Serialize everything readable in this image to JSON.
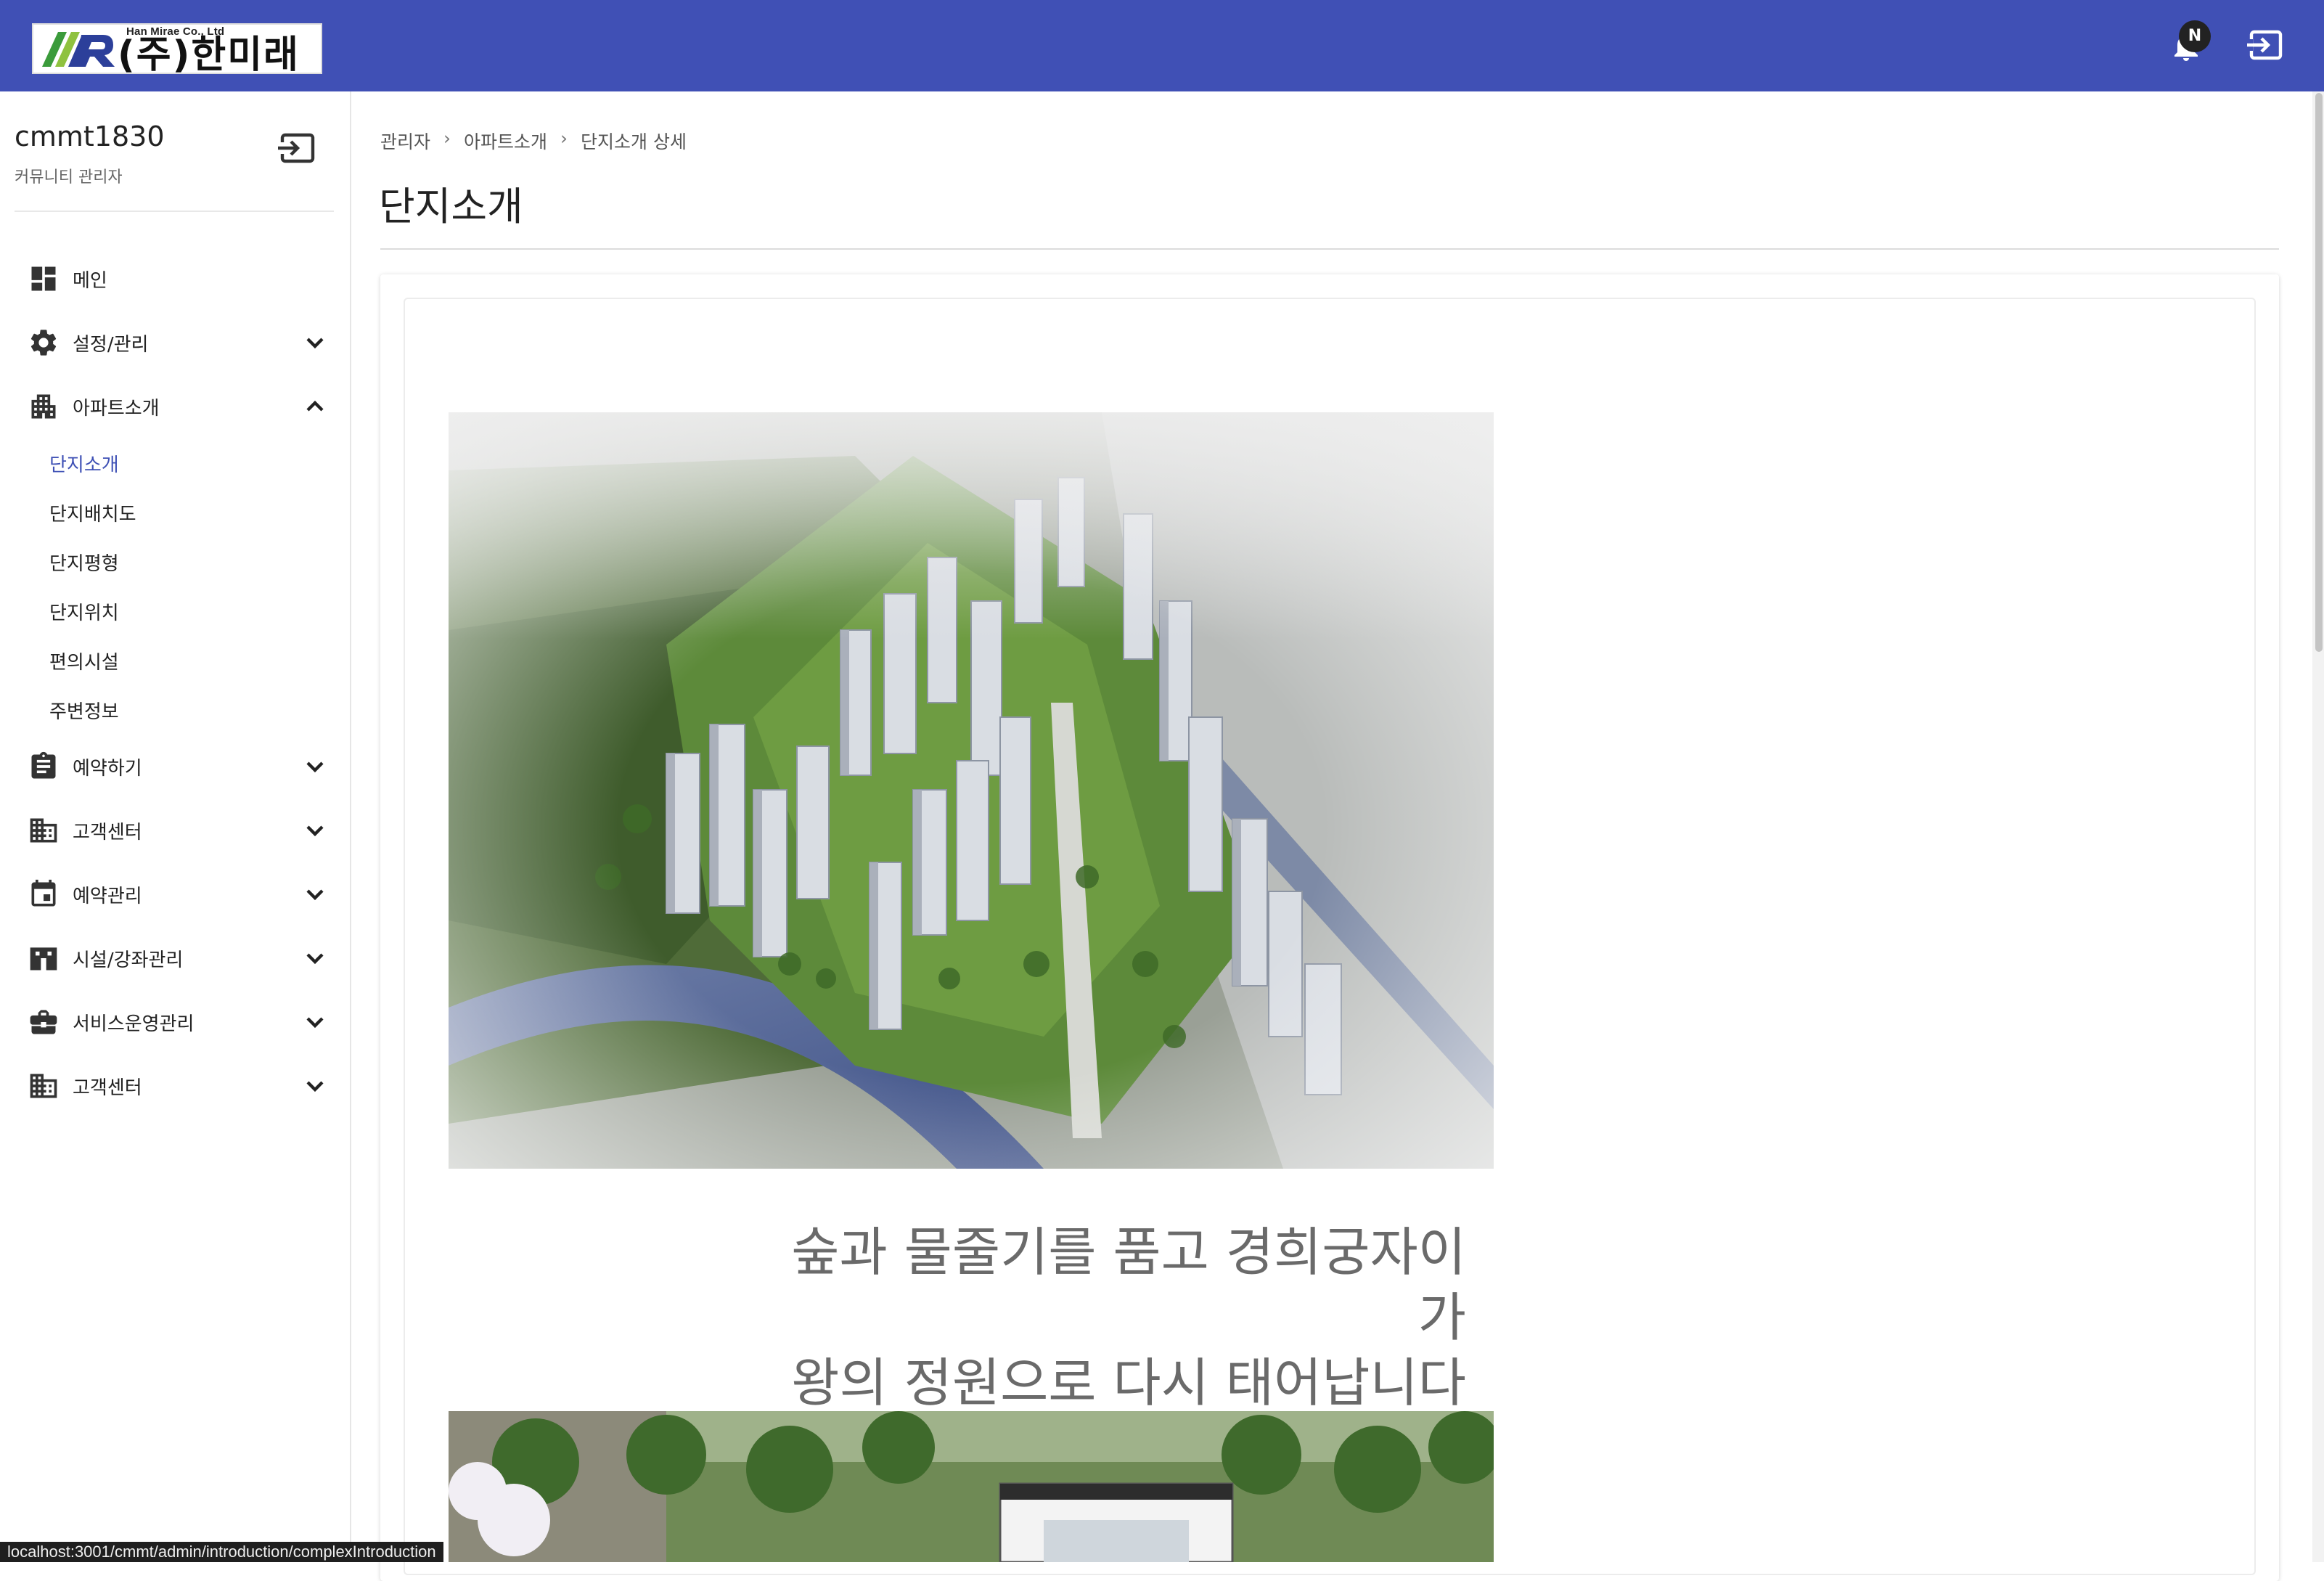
{
  "header": {
    "logo_subtitle": "Han Mirae Co., Ltd",
    "logo_text": "(주)한미래",
    "notification_badge": "N",
    "brand_color": "#4050b5"
  },
  "sidebar": {
    "user_name": "cmmt1830",
    "user_role": "커뮤니티 관리자",
    "menu": [
      {
        "label": "메인",
        "icon": "dashboard-icon"
      },
      {
        "label": "설정/관리",
        "icon": "gear-icon",
        "expanded": false
      },
      {
        "label": "아파트소개",
        "icon": "apartment-icon",
        "expanded": true
      },
      {
        "label": "예약하기",
        "icon": "clipboard-icon",
        "expanded": false
      },
      {
        "label": "고객센터",
        "icon": "building-icon",
        "expanded": false
      },
      {
        "label": "예약관리",
        "icon": "calendar-icon",
        "expanded": false
      },
      {
        "label": "시설/강좌관리",
        "icon": "facility-icon",
        "expanded": false
      },
      {
        "label": "서비스운영관리",
        "icon": "briefcase-icon",
        "expanded": false
      },
      {
        "label": "고객센터",
        "icon": "building-icon",
        "expanded": false
      }
    ],
    "submenu": [
      {
        "label": "단지소개",
        "active": true
      },
      {
        "label": "단지배치도",
        "active": false
      },
      {
        "label": "단지평형",
        "active": false
      },
      {
        "label": "단지위치",
        "active": false
      },
      {
        "label": "편의시설",
        "active": false
      },
      {
        "label": "주변정보",
        "active": false
      }
    ],
    "active_color": "#3f51b5"
  },
  "main": {
    "breadcrumb": [
      "관리자",
      "아파트소개",
      "단지소개 상세"
    ],
    "breadcrumb_separator": "›",
    "title": "단지소개",
    "slogan_line1": "숲과 물줄기를 품고 경희궁자이가",
    "slogan_line2": "왕의 정원으로 다시 태어납니다"
  },
  "status_bar": {
    "url": "localhost:3001/cmmt/admin/introduction/complexIntroduction"
  }
}
